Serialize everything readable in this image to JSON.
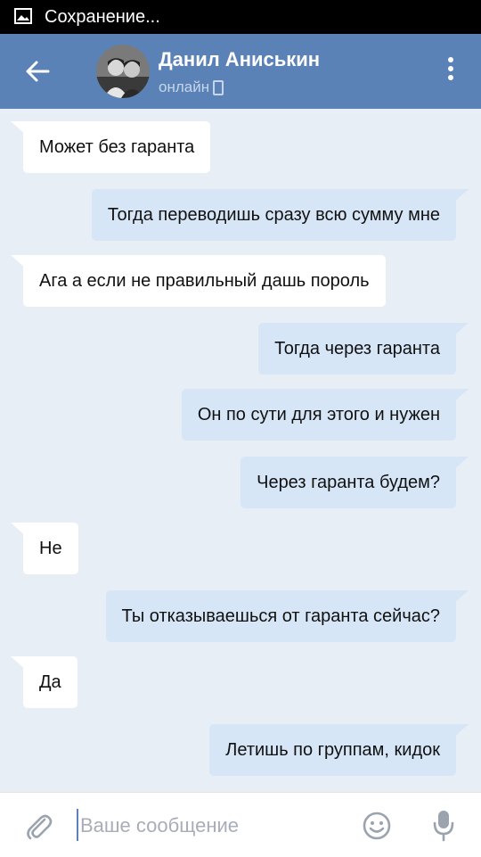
{
  "status_bar": {
    "notification_icon": "image-icon",
    "text": "Сохранение..."
  },
  "header": {
    "back_icon": "arrow-left-icon",
    "contact_name": "Данил Аниськин",
    "presence": "онлайн",
    "presence_icon": "phone-icon",
    "more_icon": "more-vertical-icon"
  },
  "messages": [
    {
      "direction": "in",
      "text": "Может без гаранта"
    },
    {
      "direction": "out",
      "text": "Тогда переводишь сразу всю сумму мне"
    },
    {
      "direction": "in",
      "text": "Ага а если не правильный дашь пороль"
    },
    {
      "direction": "out",
      "text": "Тогда через гаранта"
    },
    {
      "direction": "out",
      "text": "Он по сути для этого и нужен"
    },
    {
      "direction": "out",
      "text": "Через гаранта будем?"
    },
    {
      "direction": "in",
      "text": "Не"
    },
    {
      "direction": "out",
      "text": "Ты отказываешься от гаранта сейчас?"
    },
    {
      "direction": "in",
      "text": "Да"
    },
    {
      "direction": "out",
      "text": "Летишь по группам, кидок"
    }
  ],
  "composer": {
    "placeholder": "Ваше сообщение",
    "value": "",
    "attach_icon": "paperclip-icon",
    "emoji_icon": "smiley-icon",
    "mic_icon": "microphone-icon"
  },
  "colors": {
    "header_bg": "#5b82b7",
    "chat_bg": "#e8eef5",
    "bubble_in": "#ffffff",
    "bubble_out": "#d6e6f7",
    "status_bar_bg": "#000000"
  }
}
